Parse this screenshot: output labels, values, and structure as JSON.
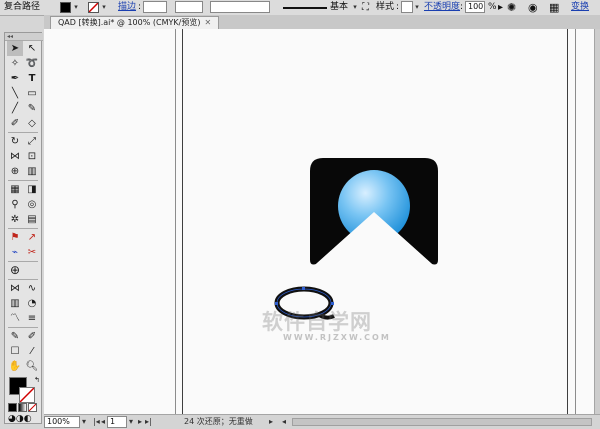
{
  "control_bar": {
    "object_type": "复合路径",
    "stroke_label": "描边",
    "stroke_profile": "基本",
    "style_label": "样式",
    "opacity_label": "不透明度",
    "opacity_value": "100",
    "opacity_unit": "%",
    "transform_label": "变换"
  },
  "document": {
    "tab_title": "QAD [转换].ai* @ 100% (CMYK/预览)",
    "close": "✕"
  },
  "status_bar": {
    "zoom": "100%",
    "artboard": "1",
    "status": "24 次还原；无重做"
  },
  "watermark": {
    "text": "软件自学网",
    "url": "WWW.RJZXW.COM"
  },
  "colors": {
    "fill": "#000000",
    "logo_dark": "#080808",
    "sphere_light": "#d8efff",
    "sphere_dark": "#1d8fd9"
  }
}
